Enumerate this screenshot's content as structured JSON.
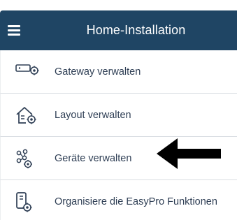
{
  "header": {
    "title": "Home-Installation",
    "menu_icon": "hamburger-menu-icon",
    "background": "#1f4564"
  },
  "menu": {
    "items": [
      {
        "label": "Gateway verwalten",
        "icon": "gateway-settings-icon"
      },
      {
        "label": "Layout verwalten",
        "icon": "house-settings-icon"
      },
      {
        "label": "Geräte verwalten",
        "icon": "devices-settings-icon"
      },
      {
        "label": "Organisiere die EasyPro Funktionen",
        "icon": "device-function-settings-icon"
      }
    ]
  },
  "annotation": {
    "icon": "black-arrow-left-icon",
    "points_to_item": "Geräte verwalten"
  }
}
